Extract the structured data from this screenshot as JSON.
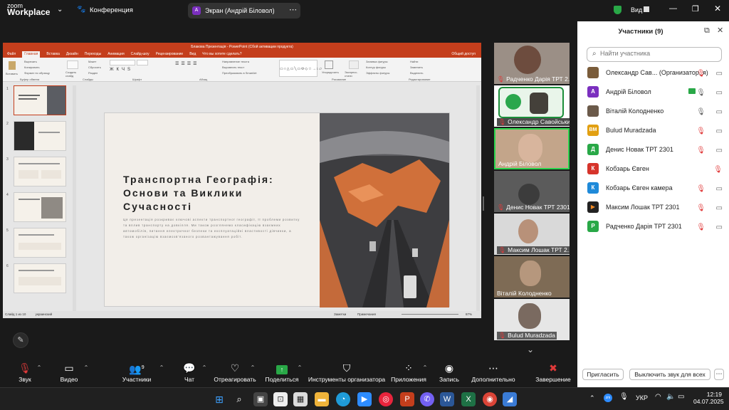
{
  "app": {
    "brand_top": "zoom",
    "brand_bottom": "Workplace",
    "meeting": "Конференция",
    "share_label": "Экран (Андрій Біловол)",
    "share_avatar": "A",
    "view": "Вид"
  },
  "ppt": {
    "title": "Блакова Презентація - PowerPoint (Сбой активации продукта)",
    "tabs": [
      "Файл",
      "Главная",
      "Вставка",
      "Дизайн",
      "Переходы",
      "Анимация",
      "Слайд-шоу",
      "Рецензирование",
      "Вид",
      "Что вы хотите сделать?",
      "Общий доступ"
    ],
    "ribbon": {
      "paste": "Вставить",
      "cut": "Вырезать",
      "copy": "Копировать",
      "format": "Формат по образцу",
      "clipboard": "Буфер обмена",
      "new_slide": "Создать слайд",
      "layout": "Макет",
      "reset": "Сбросить",
      "section": "Раздел",
      "slides": "Слайды",
      "font": "Шрифт",
      "paragraph": "Абзац",
      "text_dir": "Направление текста",
      "align_text": "Выровнять текст",
      "smartart": "Преобразовать в SmartArt",
      "drawing": "Рисование",
      "arrange": "Упорядочить",
      "quick_styles": "Экспресс-стили",
      "fill": "Заливка фигуры",
      "outline": "Контур фигуры",
      "effects": "Эффекты фигуры",
      "find": "Найти",
      "replace": "Заменить",
      "select": "Выделить",
      "editing": "Редактирование"
    },
    "slide_numbers": [
      "1",
      "2",
      "3",
      "4",
      "5",
      "6"
    ],
    "slide_title": "Транспортна Географія: Основи та Виклики Сучасності",
    "slide_body": "Ця презентація розкриває ключові аспекти транспортної географії, її проблеми розвитку та вплив транспорту на довкілля. Ми також розглянемо класифікацію взаємних автомобілів, питання електричної безпеки та експлуатаційні властивості дівчинки, а також організацію взаємозв'язаного розвантажування робіт.",
    "status_left": "Слайд 1 из 10",
    "status_lang": "украинский",
    "status_notes": "Заметки",
    "status_comments": "Примечания",
    "zoom": "87%"
  },
  "tiles": [
    {
      "name": "Радченко Дарія ТРТ 2...",
      "muted": true
    },
    {
      "name": "Олександр Савойськи...",
      "muted": true
    },
    {
      "name": "Андрій Біловол",
      "muted": false
    },
    {
      "name": "Денис Новак ТРТ 2301",
      "muted": true
    },
    {
      "name": "Максим Лошак ТРТ 2...",
      "muted": true
    },
    {
      "name": "Віталій Колодненко",
      "muted": false
    },
    {
      "name": "Bulud Muradzada",
      "muted": true
    }
  ],
  "panel": {
    "title": "Участники (9)",
    "search_placeholder": "Найти участника",
    "participants": [
      {
        "avatar": "",
        "name": "Олександр Сав...",
        "role": "(Организатор, я)",
        "color": "#7a5c3a",
        "mic": "muted",
        "cam": "on"
      },
      {
        "avatar": "А",
        "name": "Андрій Біловол",
        "role": "",
        "color": "#7b2fbf",
        "mic": "on",
        "cam": "on"
      },
      {
        "avatar": "",
        "name": "Віталій Колодненко",
        "role": "",
        "color": "#6b5a4a",
        "mic": "on",
        "cam": "on"
      },
      {
        "avatar": "BM",
        "name": "Bulud Muradzada",
        "role": "",
        "color": "#e2a012",
        "mic": "muted",
        "cam": "on"
      },
      {
        "avatar": "Д",
        "name": "Денис Новак ТРТ 2301",
        "role": "",
        "color": "#29a847",
        "mic": "muted",
        "cam": "on"
      },
      {
        "avatar": "К",
        "name": "Кобзарь Євген",
        "role": "",
        "color": "#d6342b",
        "mic": "muted",
        "cam": ""
      },
      {
        "avatar": "К",
        "name": "Кобзарь Євген камера",
        "role": "",
        "color": "#1f8ad9",
        "mic": "muted",
        "cam": "on"
      },
      {
        "avatar": "",
        "name": "Максим Лошак ТРТ 2301",
        "role": "",
        "color": "#222",
        "mic": "muted",
        "cam": "on"
      },
      {
        "avatar": "Р",
        "name": "Радченко Дарія ТРТ 2301",
        "role": "",
        "color": "#29a847",
        "mic": "muted",
        "cam": "on"
      }
    ],
    "invite": "Пригласить",
    "mute_all": "Выключить звук для всех"
  },
  "toolbar": {
    "audio": "Звук",
    "video": "Видео",
    "participants": "Участники",
    "participants_count": "9",
    "chat": "Чат",
    "react": "Отреагировать",
    "share": "Поделиться",
    "host_tools": "Инструменты организатора",
    "apps": "Приложения",
    "record": "Запись",
    "more": "Дополнительно",
    "end": "Завершение"
  },
  "taskbar": {
    "lang": "УКР",
    "time": "12:19",
    "date": "04.07.2025"
  }
}
